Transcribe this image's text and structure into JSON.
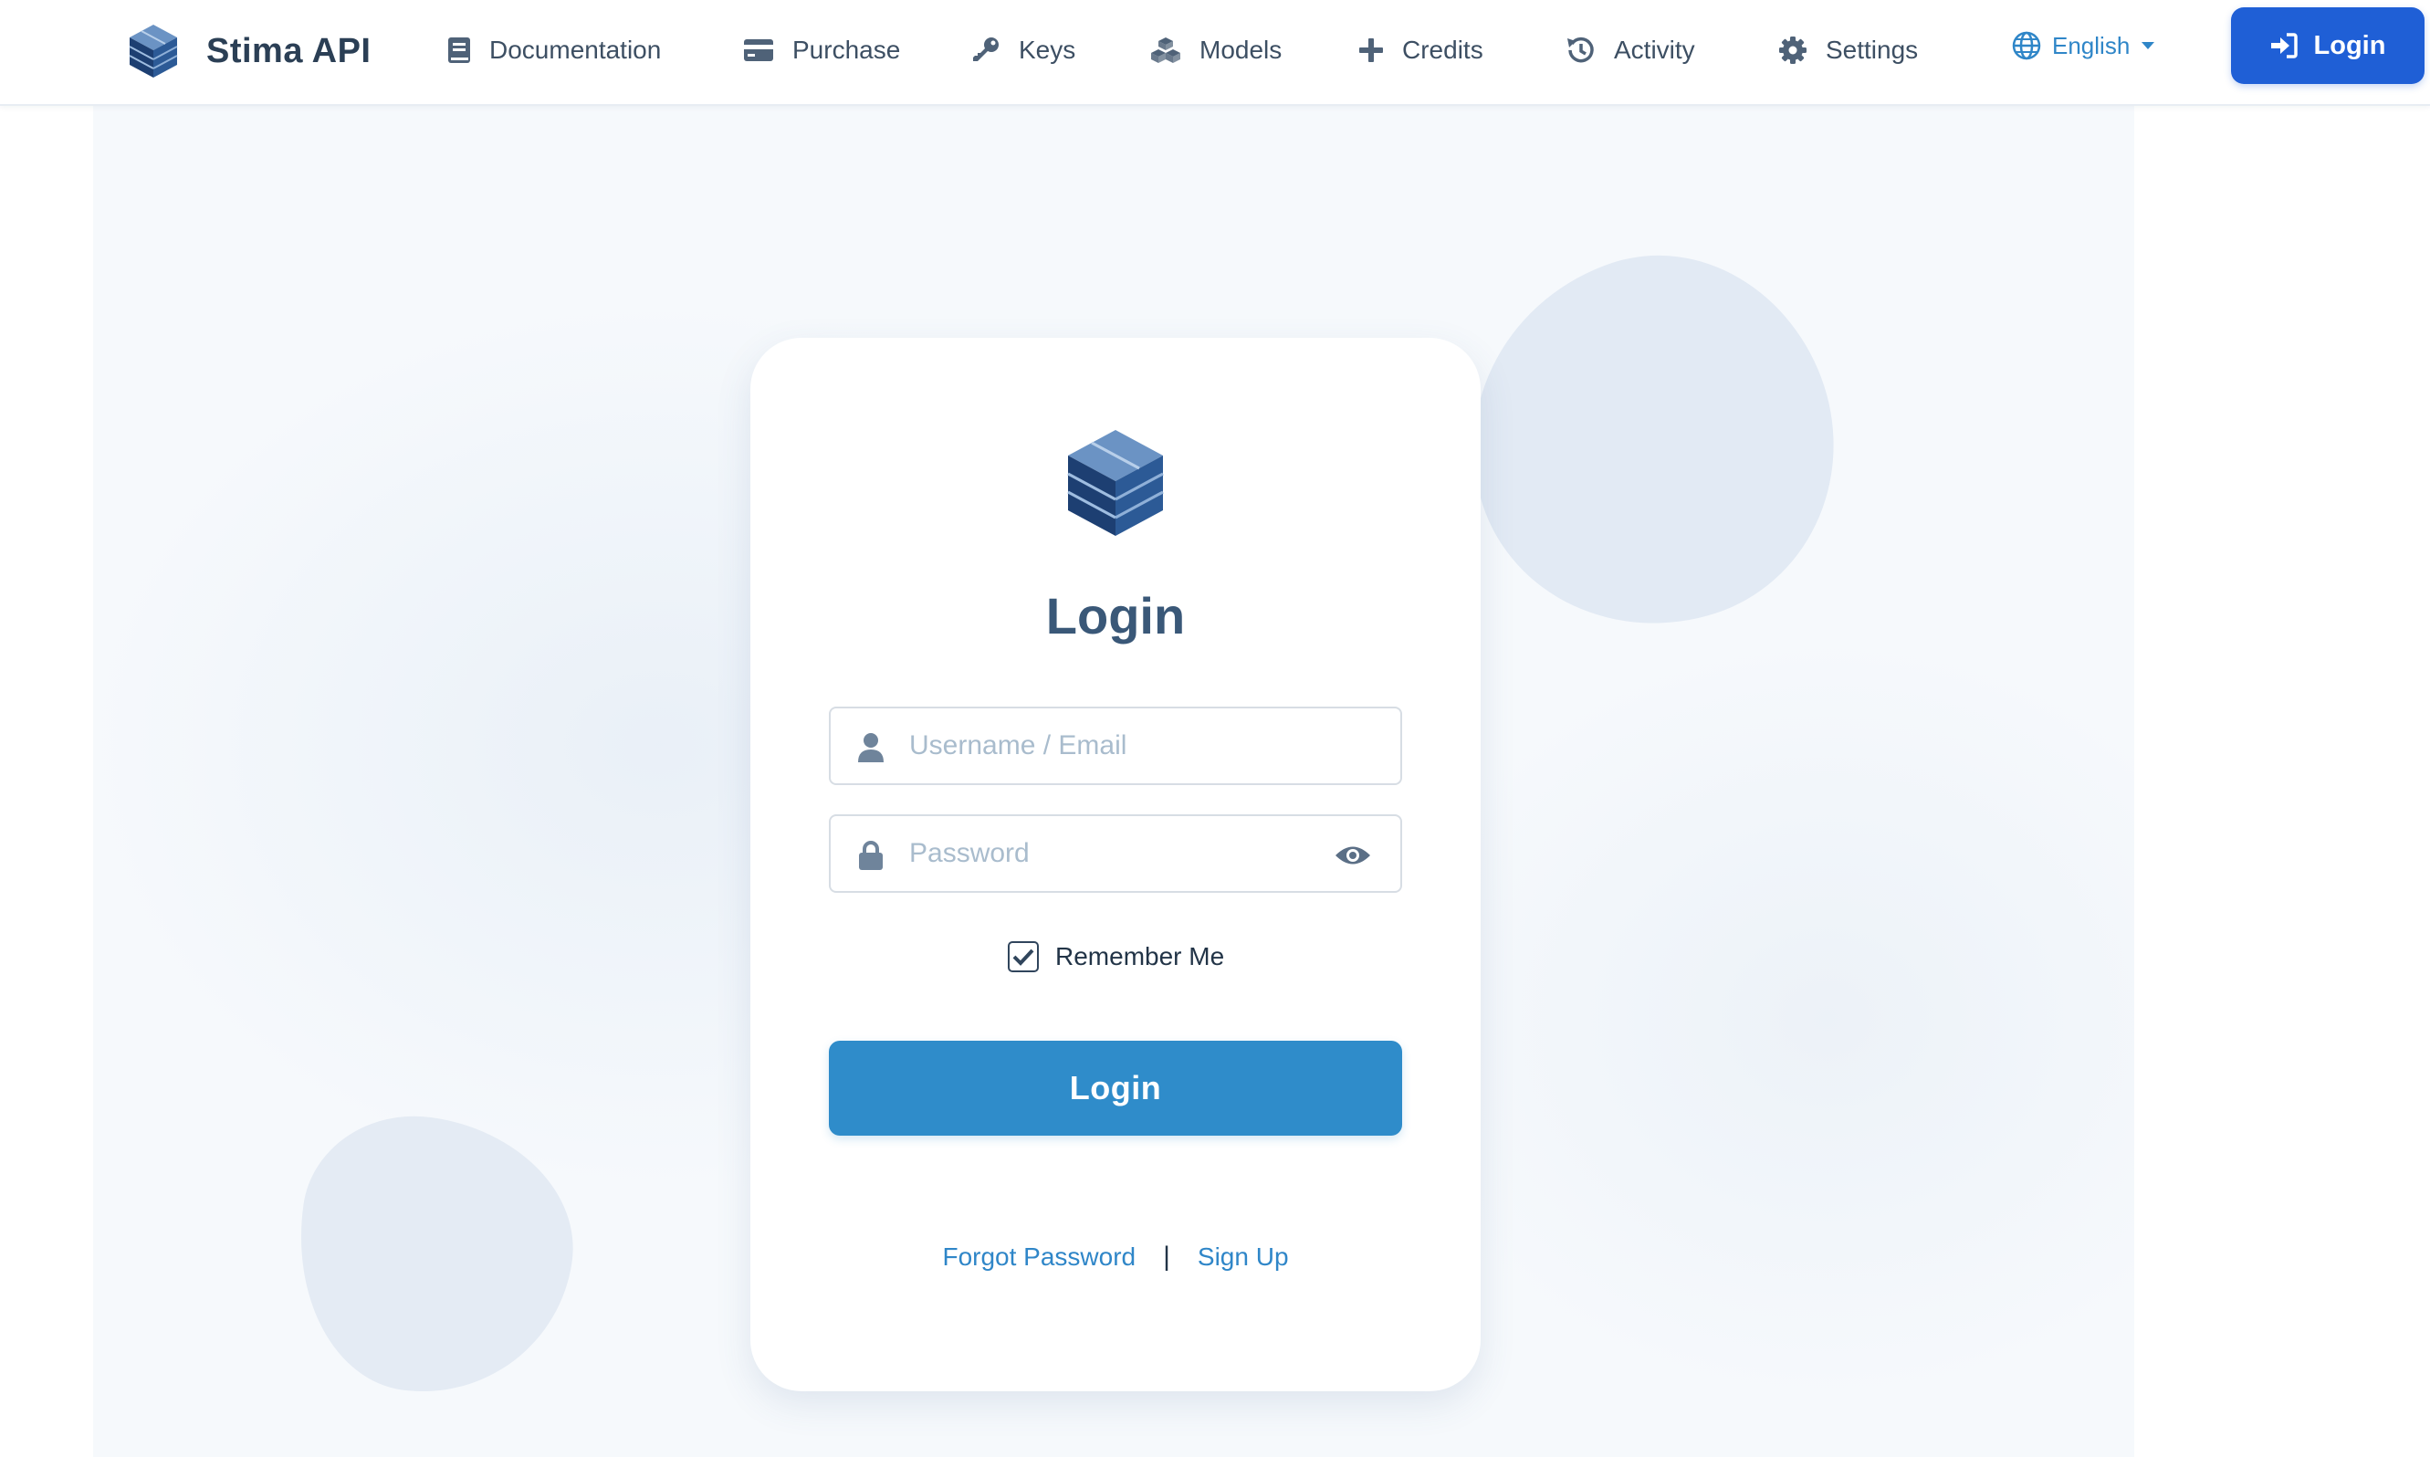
{
  "brand": {
    "name": "Stima API",
    "logo_icon": "cube-logo-icon"
  },
  "nav": {
    "items": [
      {
        "label": "Documentation",
        "icon": "book-icon"
      },
      {
        "label": "Purchase",
        "icon": "credit-card-icon"
      },
      {
        "label": "Keys",
        "icon": "key-icon"
      },
      {
        "label": "Models",
        "icon": "cubes-icon"
      },
      {
        "label": "Credits",
        "icon": "plus-icon"
      },
      {
        "label": "Activity",
        "icon": "history-icon"
      },
      {
        "label": "Settings",
        "icon": "gear-icon"
      }
    ],
    "language": {
      "label": "English",
      "icon": "globe-icon"
    },
    "login_button": {
      "label": "Login",
      "icon": "sign-in-icon"
    }
  },
  "login_form": {
    "title": "Login",
    "username": {
      "placeholder": "Username / Email",
      "value": "",
      "icon": "user-icon"
    },
    "password": {
      "placeholder": "Password",
      "value": "",
      "icon": "lock-icon",
      "toggle_icon": "eye-icon"
    },
    "remember_me": {
      "label": "Remember Me",
      "checked": true
    },
    "submit_label": "Login",
    "forgot_password_label": "Forgot Password",
    "separator": "|",
    "sign_up_label": "Sign Up"
  },
  "colors": {
    "primary_button": "#1f5fd6",
    "submit_button": "#2f8cca",
    "link": "#2f86c8",
    "title": "#3a5878",
    "background": "#f6f9fc"
  }
}
